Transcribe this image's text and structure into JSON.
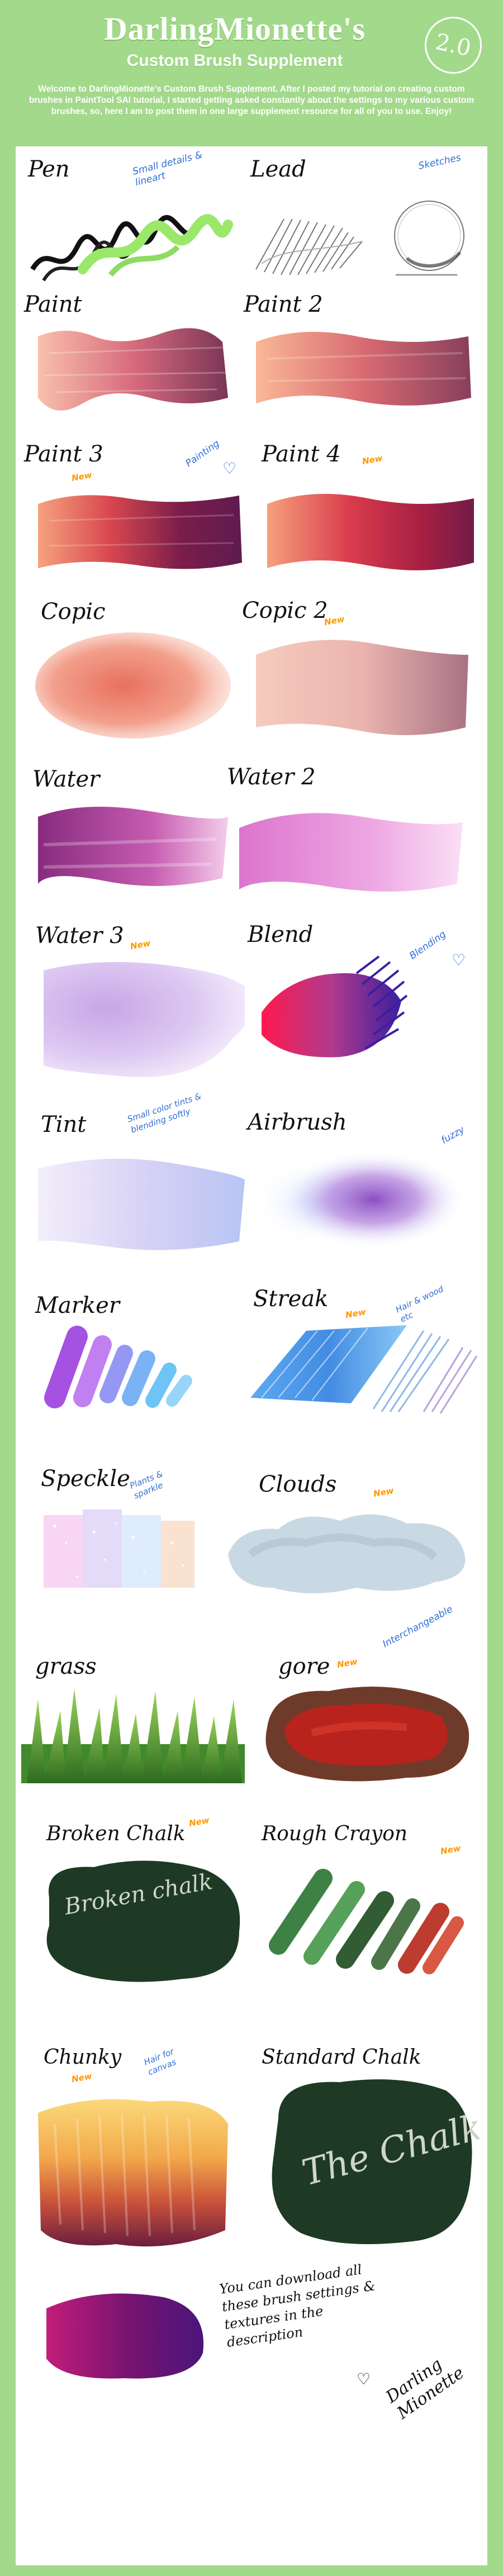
{
  "header": {
    "title": "DarlingMionette's",
    "subtitle": "Custom Brush Supplement",
    "version": "2.0",
    "intro": "Welcome to DarlingMionette's Custom Brush Supplement. After I posted my tutorial on creating custom brushes in PaintTool SAI tutorial, I started getting asked constantly about the settings to my various custom brushes, so, here I am to post them in one large supplement resource for all of you to use. Enjoy!"
  },
  "brushes": {
    "pen": {
      "label": "Pen",
      "note": "Small details & lineart"
    },
    "lead": {
      "label": "Lead",
      "note": "Sketches"
    },
    "paint": {
      "label": "Paint"
    },
    "paint2": {
      "label": "Paint 2"
    },
    "paint3": {
      "label": "Paint 3",
      "new": "New",
      "note": "Painting"
    },
    "paint4": {
      "label": "Paint 4",
      "new": "New"
    },
    "copic": {
      "label": "Copic"
    },
    "copic2": {
      "label": "Copic 2",
      "new": "New"
    },
    "water": {
      "label": "Water"
    },
    "water2": {
      "label": "Water 2"
    },
    "water3": {
      "label": "Water 3",
      "new": "New"
    },
    "blend": {
      "label": "Blend",
      "note": "Blending"
    },
    "tint": {
      "label": "Tint",
      "note": "Small color tints & blending softly"
    },
    "airbrush": {
      "label": "Airbrush",
      "note": "fuzzy"
    },
    "marker": {
      "label": "Marker"
    },
    "streak": {
      "label": "Streak",
      "new": "New",
      "note": "Hair & wood etc"
    },
    "speckle": {
      "label": "Speckle",
      "note": "Plants & sparkle"
    },
    "clouds": {
      "label": "Clouds",
      "new": "New",
      "note": "Interchangeable"
    },
    "grass": {
      "label": "grass"
    },
    "gore": {
      "label": "gore",
      "new": "New"
    },
    "broken_chalk": {
      "label": "Broken Chalk",
      "new": "New",
      "sample": "Broken chalk"
    },
    "rough_crayon": {
      "label": "Rough Crayon",
      "new": "New"
    },
    "chunky": {
      "label": "Chunky",
      "new": "New",
      "note": "Hair for canvas"
    },
    "standard_chalk": {
      "label": "Standard Chalk",
      "sample": "The Chalk"
    }
  },
  "closing": {
    "message": "You can download all these brush settings & textures in the description",
    "heart": "♡",
    "signature": "Darling Mionette"
  },
  "colors": {
    "background": "#a3d98b",
    "panel": "#ffffff",
    "note": "#2f6fd6",
    "new_tag": "#ff9800",
    "chalkboard": "#1e3a24"
  }
}
